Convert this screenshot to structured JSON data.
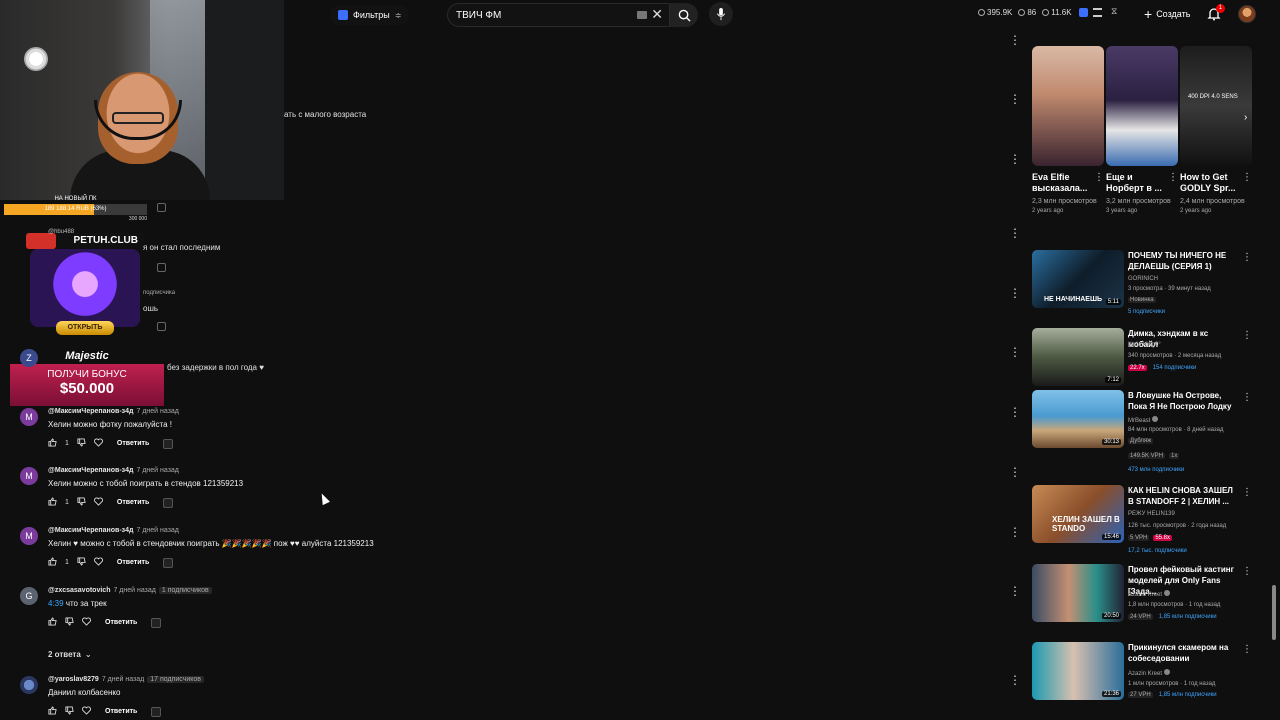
{
  "header": {
    "filter_label": "Фильтры",
    "search_value": "ТВИЧ ФМ",
    "stats": [
      "395.9K",
      "86",
      "11.6K"
    ],
    "create_label": "Создать",
    "notifications_count": "1"
  },
  "overlay": {
    "donate_title": "НА НОВЫЙ ПК",
    "donate_progress": 0.63,
    "donate_amount": "189 188.14 RUB (63%)",
    "donate_goal": "300 000",
    "promo_title": "PETUH.CLUB",
    "promo_button": "ОТКРЫТЬ",
    "majestic_logo": "Majestic",
    "majestic_bonus": "ПОЛУЧИ БОНУС",
    "majestic_sum": "$50.000"
  },
  "fragments": {
    "f1": "ать с малого возраста",
    "f2": "я он стал последним",
    "f3": "подписчика",
    "f4": "ошь",
    "f5": "без задержки в пол года ♥",
    "f6": "@hbu488"
  },
  "comments": [
    {
      "initial": "M",
      "user": "@МаксимЧерепанов-з4д",
      "time": "7 дней назад",
      "text": "Хелин можно фотку пожалуйста !",
      "likes": "1",
      "reply": "Ответить"
    },
    {
      "initial": "M",
      "user": "@МаксимЧерепанов-з4д",
      "time": "7 дней назад",
      "text": "Хелин можно с тобой поиграть в стендов 121359213",
      "likes": "1",
      "reply": "Ответить"
    },
    {
      "initial": "M",
      "user": "@МаксимЧерепанов-з4д",
      "time": "7 дней назад",
      "text": "Хелин ♥ можно с тобой в стендовчик поиграть 🎉🎉🎉🎉🎉 пож ♥♥ алуйста 121359213",
      "likes": "1",
      "reply": "Ответить"
    },
    {
      "initial": "G",
      "user": "@zxcsasavotovich",
      "time": "7 дней назад",
      "subs": "1 подписчиков",
      "link": "4:39",
      "text": "что за трек",
      "likes": "",
      "reply": "Ответить"
    },
    {
      "initial": "",
      "user": "@yaroslav8279",
      "time": "7 дней назад",
      "subs": "17 подписчиков",
      "text": "Даниил колбасенко",
      "likes": "",
      "reply": "Ответить"
    }
  ],
  "replies_toggle": "2 ответа",
  "shorts": [
    {
      "title": "Eva Elfie высказала...",
      "views": "2,3 млн просмотров",
      "age": "2 years ago"
    },
    {
      "title": "Еще и Норберт в ...",
      "views": "3,2 млн просмотров",
      "age": "3 years ago"
    },
    {
      "title": "How to Get GODLY Spr...",
      "views": "2,4 млн просмотров",
      "age": "2 years ago",
      "thumb_text": "400 DPI 4.0 SENS"
    }
  ],
  "videos": [
    {
      "title": "ПОЧЕМУ ТЫ НИЧЕГО НЕ ДЕЛАЕШЬ (СЕРИЯ 1)",
      "channel": "GORINICH",
      "meta": "3 просмотра · 39 минут назад",
      "badge": "Новинка",
      "subs": "5 подписчики",
      "duration": "5:11",
      "thumb_caption": "НЕ НАЧИНАЕШЬ"
    },
    {
      "title": "Димка, хэндкам в кс мобайл",
      "channel": "Kn1viKing0°",
      "meta": "340 просмотров · 2 месяца назад",
      "badge_hot": "22.7x",
      "subs": "154 подписчики",
      "duration": "7:12"
    },
    {
      "title": "В Ловушке На Острове, Пока Я Не Построю Лодку",
      "channel": "MrBeast",
      "meta": "84 млн просмотров · 8 дней назад",
      "badge": "Дубляж",
      "vph": "149.5K VPH",
      "mult": "1x",
      "subs": "473 млн подписчики",
      "duration": "30:13"
    },
    {
      "title": "КАК HELIN СНОВА ЗАШЕЛ В STANDOFF 2 | ХЕЛИН ...",
      "channel": "РЕЖУ HELIN139",
      "meta": "126 тыс. просмотров · 2 года назад",
      "vph": "5 VPH",
      "badge_hot": "55.8x",
      "subs": "17,2 тыс. подписчики",
      "duration": "15:46",
      "thumb_caption": "ХЕЛИН ЗАШЕЛ В STANDO"
    },
    {
      "title": "Провел фейковый кастинг моделей для Only Fans [Зада...",
      "channel": "Azazin Kreet",
      "meta": "1,8 млн просмотров · 1 год назад",
      "vph": "24 VPH",
      "subs": "1,85 млн подписчики",
      "duration": "20:50"
    },
    {
      "title": "Прикинулся скамером на собеседовании",
      "channel": "Azazin Kreet",
      "meta": "1 млн просмотров · 1 год назад",
      "vph": "27 VPH",
      "subs": "1,85 млн подписчики",
      "duration": "21:36"
    }
  ],
  "colors": {
    "bg": "#0f0f0f",
    "accent": "#3ea6ff",
    "hot": "#cc0043",
    "avatar_m": "#7b3b9c",
    "avatar_g": "#5c6370"
  }
}
